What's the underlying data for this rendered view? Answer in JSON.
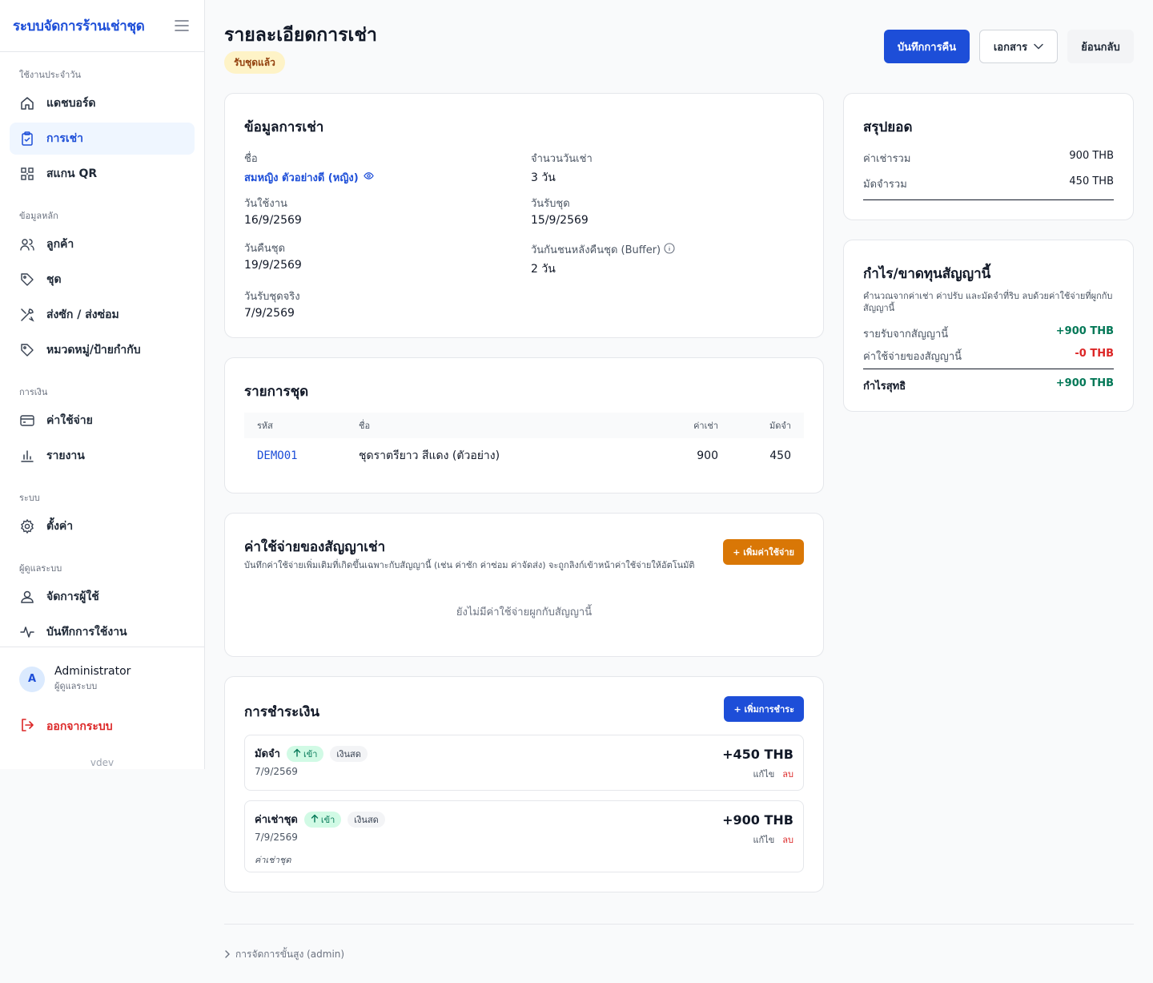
{
  "sidebar": {
    "brand": "ระบบจัดการร้านเช่าชุด",
    "sections": {
      "daily": "ใช้งานประจำวัน",
      "master": "ข้อมูลหลัก",
      "finance": "การเงิน",
      "system": "ระบบ",
      "admin": "ผู้ดูแลระบบ"
    },
    "items": {
      "dashboard": "แดชบอร์ด",
      "rentals": "การเช่า",
      "scan_qr": "สแกน QR",
      "customers": "ลูกค้า",
      "outfits": "ชุด",
      "laundry": "ส่งซัก / ส่งซ่อม",
      "categories": "หมวดหมู่/ป้ายกำกับ",
      "expenses": "ค่าใช้จ่าย",
      "reports": "รายงาน",
      "settings": "ตั้งค่า",
      "users": "จัดการผู้ใช้",
      "audit_log": "บันทึกการใช้งาน"
    },
    "user": {
      "initial": "A",
      "name": "Administrator",
      "role": "ผู้ดูแลระบบ"
    },
    "logout": "ออกจากระบบ",
    "version": "vdev"
  },
  "header": {
    "title": "รายละเอียดการเช่า",
    "status": "รับชุดแล้ว",
    "record_return": "บันทึกการคืน",
    "documents": "เอกสาร",
    "back": "ย้อนกลับ"
  },
  "rental_info": {
    "title": "ข้อมูลการเช่า",
    "name_label": "ชื่อ",
    "name_value": "สมหญิง ตัวอย่างดี (หญิง)",
    "days_label": "จำนวนวันเช่า",
    "days_value": "3 วัน",
    "use_date_label": "วันใช้งาน",
    "use_date_value": "16/9/2569",
    "pickup_date_label": "วันรับชุด",
    "pickup_date_value": "15/9/2569",
    "return_date_label": "วันคืนชุด",
    "return_date_value": "19/9/2569",
    "buffer_label": "วันกันชนหลังคืนชุด (Buffer)",
    "buffer_value": "2 วัน",
    "actual_pickup_label": "วันรับชุดจริง",
    "actual_pickup_value": "7/9/2569"
  },
  "items": {
    "title": "รายการชุด",
    "columns": {
      "code": "รหัส",
      "name": "ชื่อ",
      "rent": "ค่าเช่า",
      "deposit": "มัดจำ"
    },
    "rows": [
      {
        "code": "DEMO01",
        "name": "ชุดราตรียาว สีแดง (ตัวอย่าง)",
        "rent": "900",
        "deposit": "450"
      }
    ]
  },
  "expenses": {
    "title": "ค่าใช้จ่ายของสัญญาเช่า",
    "subtitle": "บันทึกค่าใช้จ่ายเพิ่มเติมที่เกิดขึ้นเฉพาะกับสัญญานี้ (เช่น ค่าซัก ค่าซ่อม ค่าจัดส่ง) จะถูกลิงก์เข้าหน้าค่าใช้จ่ายให้อัตโนมัติ",
    "add_button": "+ เพิ่มค่าใช้จ่าย",
    "empty": "ยังไม่มีค่าใช้จ่ายผูกกับสัญญานี้"
  },
  "payments": {
    "title": "การชำระเงิน",
    "add_button": "+ เพิ่มการชำระ",
    "edit_label": "แก้ไข",
    "delete_label": "ลบ",
    "list": [
      {
        "type": "มัดจำ",
        "direction": "เข้า",
        "method": "เงินสด",
        "date": "7/9/2569",
        "amount": "+450 THB",
        "note": ""
      },
      {
        "type": "ค่าเช่าชุด",
        "direction": "เข้า",
        "method": "เงินสด",
        "date": "7/9/2569",
        "amount": "+900 THB",
        "note": "ค่าเช่าชุด"
      }
    ]
  },
  "summary": {
    "title": "สรุปยอด",
    "rent_total_label": "ค่าเช่ารวม",
    "rent_total_value": "900 THB",
    "deposit_total_label": "มัดจำรวม",
    "deposit_total_value": "450 THB"
  },
  "profit": {
    "title": "กำไร/ขาดทุนสัญญานี้",
    "description": "คำนวณจากค่าเช่า ค่าปรับ และมัดจำที่ริบ ลบด้วยค่าใช้จ่ายที่ผูกกับสัญญานี้",
    "income_label": "รายรับจากสัญญานี้",
    "income_value": "+900 THB",
    "cost_label": "ค่าใช้จ่ายของสัญญานี้",
    "cost_value": "-0 THB",
    "net_label": "กำไรสุทธิ",
    "net_value": "+900 THB"
  },
  "footer": {
    "advanced": "การจัดการขั้นสูง (admin)"
  },
  "colors": {
    "primary": "#1d4ed8",
    "orange": "#d97706",
    "positive": "#047857",
    "negative": "#dc2626",
    "status_bg": "#fef3c7"
  }
}
